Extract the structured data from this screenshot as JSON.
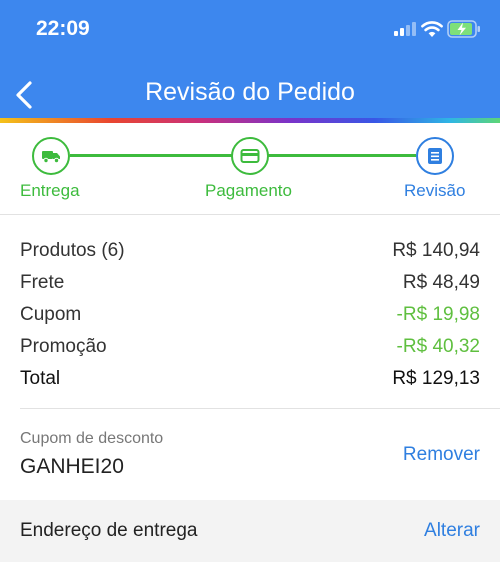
{
  "status_bar": {
    "time": "22:09"
  },
  "header": {
    "title": "Revisão do Pedido",
    "background": "#3d87ee"
  },
  "stepper": {
    "steps": [
      {
        "label": "Entrega",
        "icon": "truck-icon",
        "state": "done"
      },
      {
        "label": "Pagamento",
        "icon": "card-icon",
        "state": "done"
      },
      {
        "label": "Revisão",
        "icon": "list-icon",
        "state": "active"
      }
    ],
    "done_color": "#3dbb3d",
    "active_color": "#2f7fe0"
  },
  "summary": {
    "rows": [
      {
        "label": "Produtos (6)",
        "value": "R$ 140,94"
      },
      {
        "label": "Frete",
        "value": "R$ 48,49"
      },
      {
        "label": "Cupom",
        "value": "-R$ 19,98"
      },
      {
        "label": "Promoção",
        "value": "-R$ 40,32"
      },
      {
        "label": "Total",
        "value": "R$ 129,13"
      }
    ],
    "discount_color": "#5fbf3f"
  },
  "coupon": {
    "label": "Cupom de desconto",
    "code": "GANHEI20",
    "action": "Remover"
  },
  "address": {
    "title": "Endereço de entrega",
    "action": "Alterar"
  }
}
